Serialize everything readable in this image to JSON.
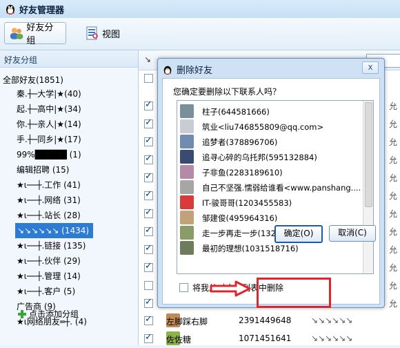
{
  "window": {
    "title": "好友管理器"
  },
  "toolbar": {
    "group_label": "好友分组",
    "view_label": "视图"
  },
  "left_panel": {
    "header": "好友分组",
    "root": "全部好友(1851)",
    "items": [
      "秦.┼─大学|★(40)",
      "起.┼─高中|★(34)",
      "你.┼─亲人|★(14)",
      "手.┼─同乡|★(17)",
      "99%█████ (1)",
      "编辑招聘 (15)",
      "★ι──┼.工作 (41)",
      "★ι──┼.网络 (31)",
      "★ι──┼.站长 (28)",
      "↘↘↘↘↘↘ (1434)",
      "★ι──┼.链接 (135)",
      "★ι──┼.伙伴 (29)",
      "★ι──┼.管理 (14)",
      "★ι──┼.客户 (5)",
      "广告商 (9)",
      "★ι网络朋友═┼. (4)"
    ],
    "selected_index": 9,
    "add_group": "点击添加分组"
  },
  "right_list": {
    "header_arrow": "↘",
    "header_col": "签",
    "rows": [
      {
        "name": "左脚踩右脚",
        "number": "2391449648",
        "sig": "↘↘↘↘↘↘",
        "checked": true
      },
      {
        "name": "佐佐糖",
        "number": "1071451641",
        "sig": "↘↘↘↘↘↘",
        "checked": true
      }
    ],
    "trail_char": "允"
  },
  "dialog": {
    "title": "删除好友",
    "close": "x",
    "question": "您确定要删除以下联系人吗？",
    "contacts": [
      "柱子(644581666)",
      "筑业<liu746855809@qq.com>",
      "追梦者(378896706)",
      "追寻心碎的乌托邦(595132884)",
      "子非鱼(2283189610)",
      "自己不坚强.懦弱给谁看<www.panshang....",
      "IT-骏哥哥(1203455583)",
      "邹建俊(495964316)",
      "走一步再走一步(1328831806)",
      "最初的理想(1031518716)"
    ],
    "remove_me_label": "将我从对方的列表中删除",
    "ok_label": "确定(O)",
    "cancel_label": "取消(C)"
  },
  "colors": {
    "highlight": "#e0242f",
    "selection": "#2e7bd4"
  }
}
